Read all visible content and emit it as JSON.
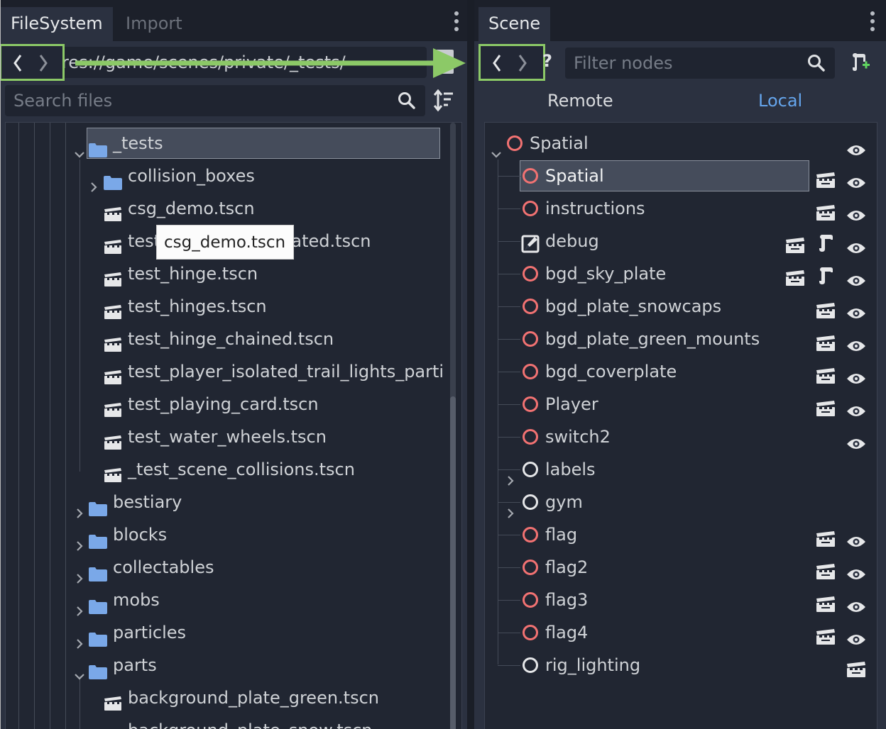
{
  "filesystem": {
    "tab_active": "FileSystem",
    "tab_inactive": "Import",
    "path": "res://game/scenes/private/_tests/",
    "search_placeholder": "Search files",
    "tree": [
      {
        "label": "_tests",
        "type": "folder",
        "expanded": true,
        "selected": true
      },
      {
        "label": "collision_boxes",
        "type": "folder",
        "expanded": false
      },
      {
        "label": "csg_demo.tscn",
        "type": "scene"
      },
      {
        "label": "test_sky_demo_isolated.tscn",
        "type": "scene"
      },
      {
        "label": "test_hinge.tscn",
        "type": "scene"
      },
      {
        "label": "test_hinges.tscn",
        "type": "scene"
      },
      {
        "label": "test_hinge_chained.tscn",
        "type": "scene"
      },
      {
        "label": "test_player_isolated_trail_lights_parti",
        "type": "scene"
      },
      {
        "label": "test_playing_card.tscn",
        "type": "scene"
      },
      {
        "label": "test_water_wheels.tscn",
        "type": "scene"
      },
      {
        "label": "_test_scene_collisions.tscn",
        "type": "scene"
      },
      {
        "label": "bestiary",
        "type": "folder",
        "expanded": false
      },
      {
        "label": "blocks",
        "type": "folder",
        "expanded": false
      },
      {
        "label": "collectables",
        "type": "folder",
        "expanded": false
      },
      {
        "label": "mobs",
        "type": "folder",
        "expanded": false
      },
      {
        "label": "particles",
        "type": "folder",
        "expanded": false
      },
      {
        "label": "parts",
        "type": "folder",
        "expanded": true
      },
      {
        "label": "background_plate_green.tscn",
        "type": "scene"
      },
      {
        "label": "background_plate_snow.tscn",
        "type": "scene"
      }
    ],
    "tooltip": "csg_demo.tscn"
  },
  "scene": {
    "tab_active": "Scene",
    "filter_placeholder": "Filter nodes",
    "help_glyph": "?",
    "remote_label": "Remote",
    "local_label": "Local",
    "nodes": [
      {
        "label": "Spatial",
        "color": "red",
        "root": true,
        "visible": true
      },
      {
        "label": "Spatial",
        "color": "red",
        "selected": true,
        "instanced": true,
        "visible": true
      },
      {
        "label": "instructions",
        "color": "red",
        "instanced": true,
        "visible": true
      },
      {
        "label": "debug",
        "color": "edit",
        "instanced": true,
        "script": true,
        "visible": true
      },
      {
        "label": "bgd_sky_plate",
        "color": "red",
        "instanced": true,
        "script": true,
        "visible": true
      },
      {
        "label": "bgd_plate_snowcaps",
        "color": "red",
        "instanced": true,
        "visible": true
      },
      {
        "label": "bgd_plate_green_mounts",
        "color": "red",
        "instanced": true,
        "visible": true
      },
      {
        "label": "bgd_coverplate",
        "color": "red",
        "instanced": true,
        "visible": true
      },
      {
        "label": "Player",
        "color": "red",
        "instanced": true,
        "visible": true
      },
      {
        "label": "switch2",
        "color": "red",
        "visible": true
      },
      {
        "label": "labels",
        "color": "white",
        "expander": true
      },
      {
        "label": "gym",
        "color": "white",
        "expander": true
      },
      {
        "label": "flag",
        "color": "red",
        "instanced": true,
        "visible": true
      },
      {
        "label": "flag2",
        "color": "red",
        "instanced": true,
        "visible": true
      },
      {
        "label": "flag3",
        "color": "red",
        "instanced": true,
        "visible": true
      },
      {
        "label": "flag4",
        "color": "red",
        "instanced": true,
        "visible": true
      },
      {
        "label": "rig_lighting",
        "color": "white",
        "instanced_only": true
      }
    ]
  },
  "colors": {
    "panel_bg": "#202531",
    "tree_bg": "#212632",
    "highlight_box": "#8cc967",
    "node_red": "#f27272",
    "folder_blue": "#7aa8e8",
    "local_tab": "#65a5ec"
  }
}
